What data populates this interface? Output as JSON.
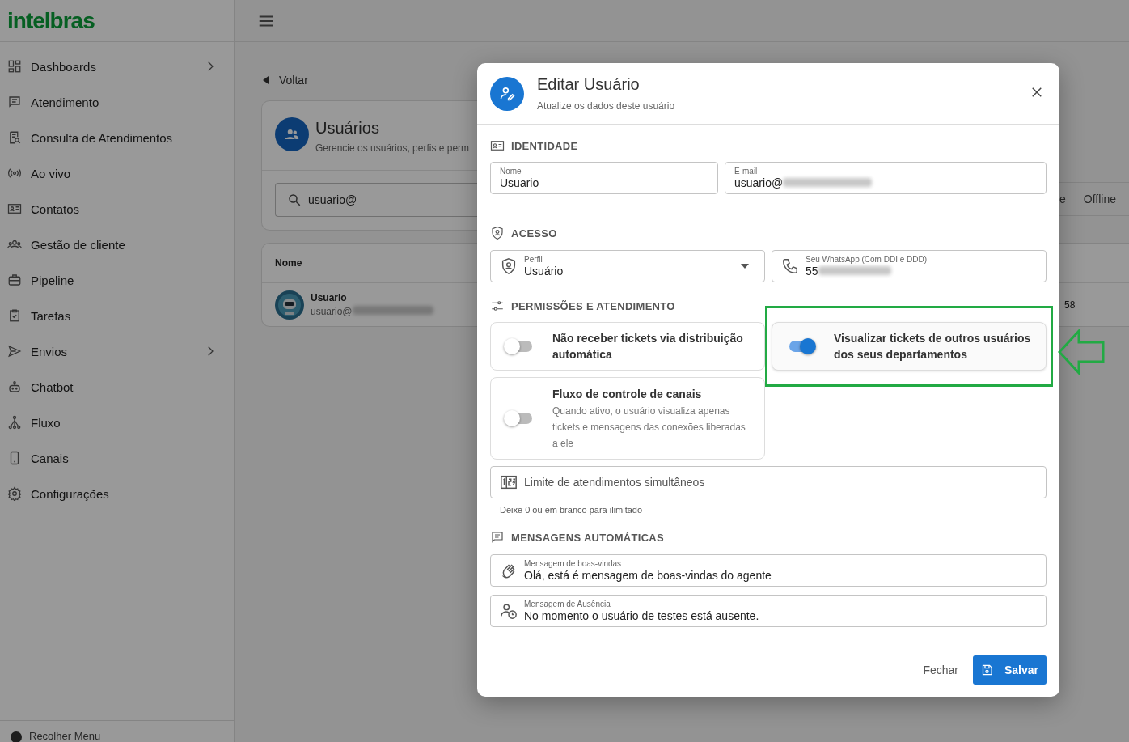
{
  "sidebar": {
    "logo": "intelbras",
    "items": [
      {
        "label": "Dashboards",
        "has_submenu": true
      },
      {
        "label": "Atendimento",
        "has_submenu": false
      },
      {
        "label": "Consulta de Atendimentos",
        "has_submenu": false
      },
      {
        "label": "Ao vivo",
        "has_submenu": false
      },
      {
        "label": "Contatos",
        "has_submenu": false
      },
      {
        "label": "Gestão de cliente",
        "has_submenu": false
      },
      {
        "label": "Pipeline",
        "has_submenu": false
      },
      {
        "label": "Tarefas",
        "has_submenu": false
      },
      {
        "label": "Envios",
        "has_submenu": true
      },
      {
        "label": "Chatbot",
        "has_submenu": false
      },
      {
        "label": "Fluxo",
        "has_submenu": false
      },
      {
        "label": "Canais",
        "has_submenu": false
      },
      {
        "label": "Configurações",
        "has_submenu": false
      }
    ],
    "collapse": "Recolher Menu"
  },
  "page": {
    "back": "Voltar",
    "title": "Usuários",
    "subtitle": "Gerencie os usuários, perfis e perm",
    "search": {
      "value": "usuario@"
    },
    "filters": [
      "e",
      "Offline"
    ],
    "table": {
      "columns": [
        "Nome"
      ],
      "rows": [
        {
          "name": "Usuario",
          "email": "usuario@",
          "email_redacted": true,
          "cell_cut": "58"
        }
      ]
    }
  },
  "dialog": {
    "title": "Editar Usuário",
    "subtitle": "Atualize os dados deste usuário",
    "identity": {
      "heading": "IDENTIDADE",
      "fields": [
        {
          "label": "Nome",
          "value": "Usuario",
          "redacted": false
        },
        {
          "label": "E-mail",
          "value": "usuario@",
          "redacted": true
        }
      ]
    },
    "access": {
      "heading": "ACESSO",
      "profile": {
        "label": "Perfil",
        "value": "Usuário"
      },
      "phone": {
        "label": "Seu WhatsApp (Com DDI e DDD)",
        "value": "55",
        "redacted": true
      }
    },
    "permissions": {
      "heading": "PERMISSÕES E ATENDIMENTO",
      "toggles": [
        {
          "label": "Não receber tickets via distribuição automática",
          "on": false,
          "highlighted": false
        },
        {
          "label": "Visualizar tickets de outros usuários dos seus departamentos",
          "on": true,
          "highlighted": true
        },
        {
          "label": "Fluxo de controle de canais",
          "description": "Quando ativo, o usuário visualiza apenas tickets e mensagens das conexões liberadas a ele",
          "on": false,
          "highlighted": false
        }
      ],
      "limit": {
        "placeholder": "Limite de atendimentos simultâneos",
        "helper": "Deixe 0 ou em branco para ilimitado"
      }
    },
    "messages": {
      "heading": "MENSAGENS AUTOMÁTICAS",
      "fields": [
        {
          "label": "Mensagem de boas-vindas",
          "value": "Olá, está é mensagem de boas-vindas do agente"
        },
        {
          "label": "Mensagem de Ausência",
          "value": "No momento o usuário de testes está ausente."
        }
      ]
    },
    "buttons": {
      "cancel": "Fechar",
      "save": "Salvar"
    }
  }
}
